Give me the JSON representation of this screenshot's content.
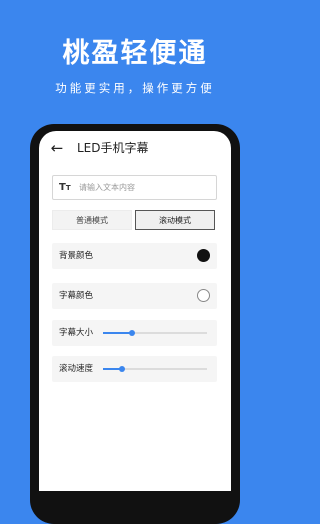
{
  "promo": {
    "headline": "桃盈轻便通",
    "subline": "功能更实用，操作更方便"
  },
  "app": {
    "back_icon": "arrow-left-icon",
    "title": "LED手机字幕",
    "input": {
      "icon": "text-size-icon",
      "placeholder": "请输入文本内容",
      "value": ""
    },
    "modes": [
      {
        "label": "普通模式",
        "selected": false
      },
      {
        "label": "滚动模式",
        "selected": true
      }
    ],
    "settings": {
      "background_color": {
        "label": "背景颜色",
        "value": "#111111"
      },
      "text_color": {
        "label": "字幕颜色",
        "value": "#ffffff"
      },
      "text_size": {
        "label": "字幕大小",
        "value": 0.28
      },
      "scroll_speed": {
        "label": "滚动速度",
        "value": 0.18
      }
    }
  },
  "colors": {
    "accent": "#3b86ee",
    "background": "#3b86ee"
  }
}
